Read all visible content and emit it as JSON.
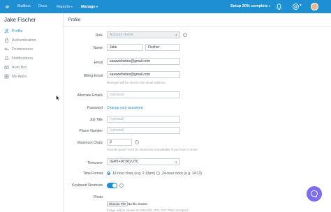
{
  "topnav": {
    "items": [
      {
        "label": "Mailbox"
      },
      {
        "label": "Docs"
      },
      {
        "label": "Reports",
        "caret": "▾"
      },
      {
        "label": "Manage",
        "caret": "▾"
      }
    ],
    "setup_label": "Setup 20% complete",
    "setup_caret": "▾",
    "colors": {
      "bar": "#1f8fd4"
    }
  },
  "sidebar": {
    "user_name": "Jake Fischer",
    "items": [
      {
        "label": "Profile",
        "icon": "person-icon",
        "active": true
      },
      {
        "label": "Authentication",
        "icon": "lock-icon"
      },
      {
        "label": "Permissions",
        "icon": "key-icon"
      },
      {
        "label": "Notifications",
        "icon": "bell-icon"
      },
      {
        "label": "Auto Bcc",
        "icon": "mail-icon"
      },
      {
        "label": "My Apps",
        "icon": "apps-icon"
      }
    ]
  },
  "main": {
    "title": "Profile",
    "form": {
      "role": {
        "label": "Role",
        "value": "Account Owner"
      },
      "name": {
        "label": "Name",
        "first": "Jake",
        "last": "Fischer"
      },
      "email": {
        "label": "Email",
        "value": "saaswebsites@gmail.com"
      },
      "billing_email": {
        "label": "Billing Email",
        "value": "saaswebsites@gmail.com",
        "hint": "Receipts will be sent to this email address."
      },
      "alternate_emails": {
        "label": "Alternate Emails",
        "placeholder": "(optional)"
      },
      "password": {
        "label": "Password",
        "link": "Change your password"
      },
      "job_title": {
        "label": "Job Title",
        "placeholder": "(optional)"
      },
      "phone": {
        "label": "Phone Number",
        "placeholder": "(optional)"
      },
      "max_chats": {
        "label": "Maximum Chats",
        "value": "3",
        "hint": "Sounds good! You'll be shown as Unavailable if you have 3 chats"
      },
      "timezone": {
        "label": "Timezone",
        "value": "(GMT+00:00) UTC"
      },
      "time_format": {
        "label": "Time Format",
        "option_12": "12-hour clock (e.g. 2:13pm)",
        "option_24": "24-hour clock (e.g. 14:13)",
        "selected": "12"
      },
      "keyboard_shortcuts": {
        "label": "Keyboard Shortcuts",
        "enabled": true
      },
      "photo": {
        "label": "Photo",
        "button": "Choose File",
        "file_text": "No file chosen",
        "hint": "Image will be shown at 100x100, JPG, GIF, PNG accepted"
      }
    }
  }
}
